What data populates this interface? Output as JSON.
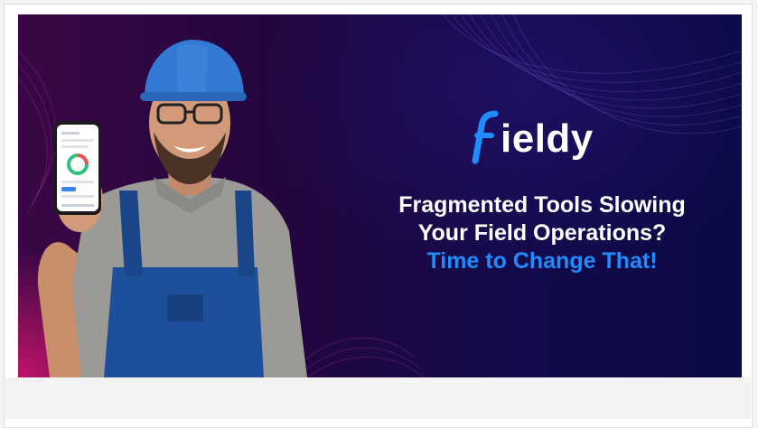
{
  "banner": {
    "brand": "fieldy",
    "headline_line1": "Fragmented Tools Slowing",
    "headline_line2": "Your Field Operations?",
    "headline_line3": "Time to Change That!",
    "colors": {
      "accent_blue": "#1f8cff",
      "magenta": "#d6166e",
      "deep_purple": "#23063e"
    },
    "icons": [
      "fieldy-logo-icon",
      "worker-illustration",
      "phone-mockup"
    ]
  }
}
